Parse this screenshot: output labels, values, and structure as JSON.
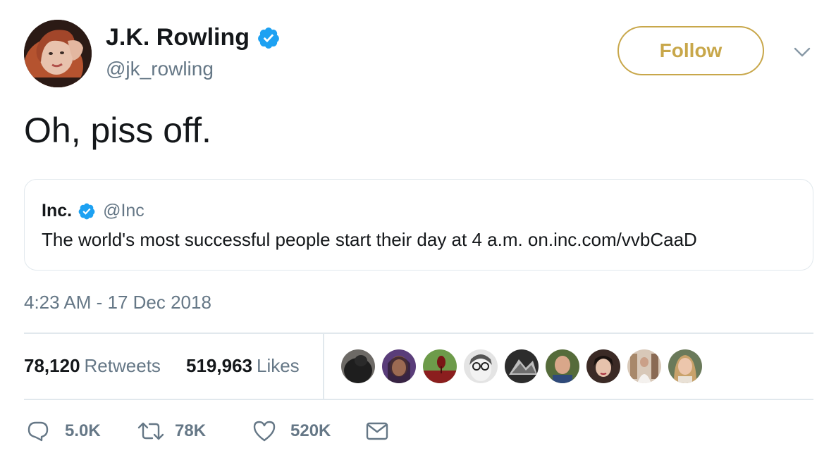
{
  "author": {
    "display_name": "J.K. Rowling",
    "handle": "@jk_rowling",
    "verified": true,
    "avatar_icon": "profile-photo"
  },
  "follow_button": {
    "label": "Follow",
    "color": "#c8a74a"
  },
  "menu_icon": "chevron-down-icon",
  "tweet_text": "Oh, piss off.",
  "quoted_tweet": {
    "display_name": "Inc.",
    "handle": "@Inc",
    "verified": true,
    "text": "The world's most successful people start their day at 4 a.m. on.inc.com/vvbCaaD"
  },
  "timestamp": "4:23 AM - 17 Dec 2018",
  "stats": {
    "retweets_count": "78,120",
    "retweets_label": "Retweets",
    "likes_count": "519,963",
    "likes_label": "Likes",
    "liker_avatars_count": 9
  },
  "actions": {
    "reply": {
      "icon": "reply-icon",
      "count": "5.0K"
    },
    "retweet": {
      "icon": "retweet-icon",
      "count": "78K"
    },
    "like": {
      "icon": "heart-icon",
      "count": "520K"
    },
    "message": {
      "icon": "envelope-icon"
    }
  },
  "colors": {
    "text_primary": "#14171a",
    "text_secondary": "#657786",
    "verified_blue": "#1da1f2",
    "border": "#e1e8ed"
  }
}
